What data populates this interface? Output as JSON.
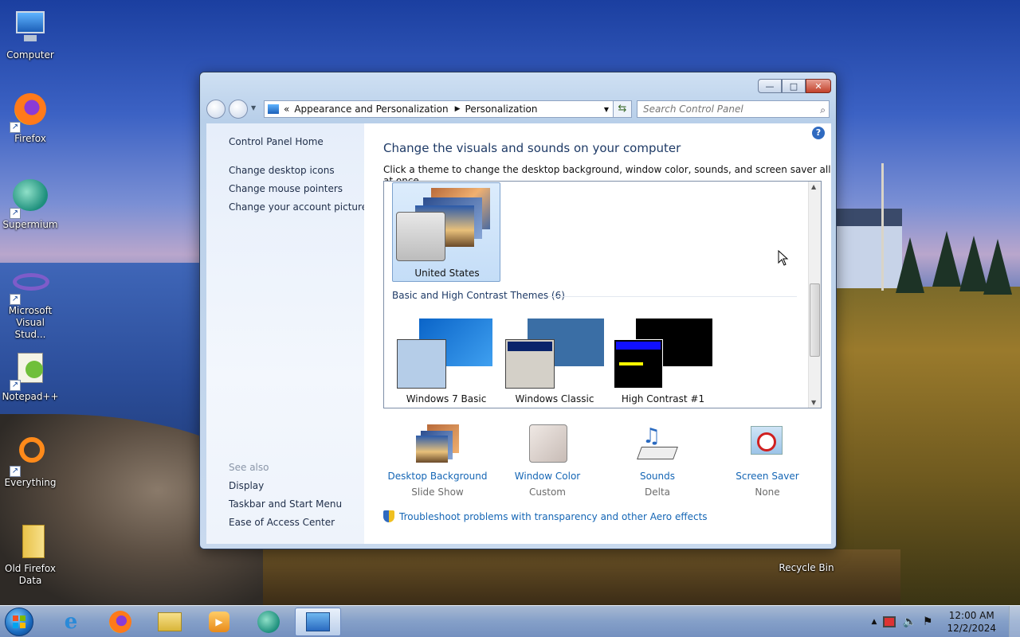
{
  "desktop": {
    "icons": [
      {
        "label": "Computer",
        "icon": "computer-icon"
      },
      {
        "label": "Firefox",
        "icon": "firefox-icon"
      },
      {
        "label": "Supermium",
        "icon": "supermium-icon"
      },
      {
        "label": "Microsoft Visual Stud...",
        "icon": "visual-studio-icon"
      },
      {
        "label": "Notepad++",
        "icon": "notepadpp-icon"
      },
      {
        "label": "Everything",
        "icon": "everything-icon"
      },
      {
        "label": "Old Firefox Data",
        "icon": "folder-icon"
      },
      {
        "label": "Recycle Bin",
        "icon": "recycle-bin-icon"
      }
    ]
  },
  "window": {
    "breadcrumb_prefix": "«",
    "breadcrumb": [
      "Appearance and Personalization",
      "Personalization"
    ],
    "search_placeholder": "Search Control Panel",
    "left_links": [
      "Control Panel Home",
      "Change desktop icons",
      "Change mouse pointers",
      "Change your account picture"
    ],
    "see_also_label": "See also",
    "see_also_links": [
      "Display",
      "Taskbar and Start Menu",
      "Ease of Access Center"
    ],
    "heading": "Change the visuals and sounds on your computer",
    "subheading": "Click a theme to change the desktop background, window color, sounds, and screen saver all at once.",
    "selected_theme": "United States",
    "group_label": "Basic and High Contrast Themes (6)",
    "basic_themes": [
      "Windows 7 Basic",
      "Windows Classic",
      "High Contrast #1"
    ],
    "tools": [
      {
        "label": "Desktop Background",
        "value": "Slide Show",
        "icon": "desktop-background-icon"
      },
      {
        "label": "Window Color",
        "value": "Custom",
        "icon": "window-color-icon"
      },
      {
        "label": "Sounds",
        "value": "Delta",
        "icon": "sounds-icon"
      },
      {
        "label": "Screen Saver",
        "value": "None",
        "icon": "screen-saver-icon"
      }
    ],
    "troubleshoot_link": "Troubleshoot problems with transparency and other Aero effects"
  },
  "taskbar": {
    "pinned": [
      "internet-explorer-icon",
      "firefox-icon",
      "file-explorer-icon",
      "media-player-icon",
      "supermium-icon",
      "control-panel-icon"
    ],
    "clock_time": "12:00 AM",
    "clock_date": "12/2/2024"
  },
  "colors": {
    "link": "#1566b5",
    "heading": "#1e3a66",
    "selection": "#c4ddf7"
  }
}
